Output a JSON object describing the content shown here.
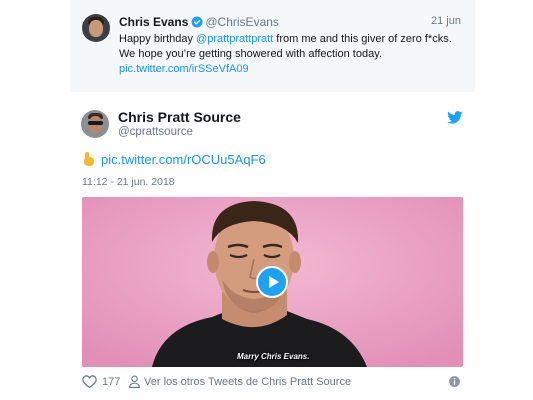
{
  "quoted_tweet": {
    "name": "Chris Evans",
    "handle": "@ChrisEvans",
    "date": "21 jun",
    "text_before": "Happy birthday ",
    "mention": "@prattprattpratt",
    "text_after": " from me and this giver of zero f*cks. We hope you’re getting showered with affection today.",
    "link": "pic.twitter.com/irSSeVfA09"
  },
  "tweet": {
    "name": "Chris Pratt Source",
    "handle": "@cprattsource",
    "link": "pic.twitter.com/rOCUu5AqF6",
    "timestamp": "11:12 - 21 jun. 2018",
    "video_caption": "Marry Chris Evans.",
    "likes": "177",
    "more_tweets": "Ver los otros Tweets de Chris Pratt Source"
  },
  "icons": {
    "verified": "verified-badge-icon",
    "bird": "twitter-bird-icon",
    "hand": "pointing-hand-emoji-icon",
    "play": "play-icon",
    "heart": "heart-icon",
    "person": "person-icon",
    "info": "info-icon"
  },
  "colors": {
    "accent": "#1da1f2",
    "link": "#1b95e0",
    "muted": "#657786",
    "quoted_bg": "#f5f8fa",
    "video_bg": "#e8a6c4"
  }
}
